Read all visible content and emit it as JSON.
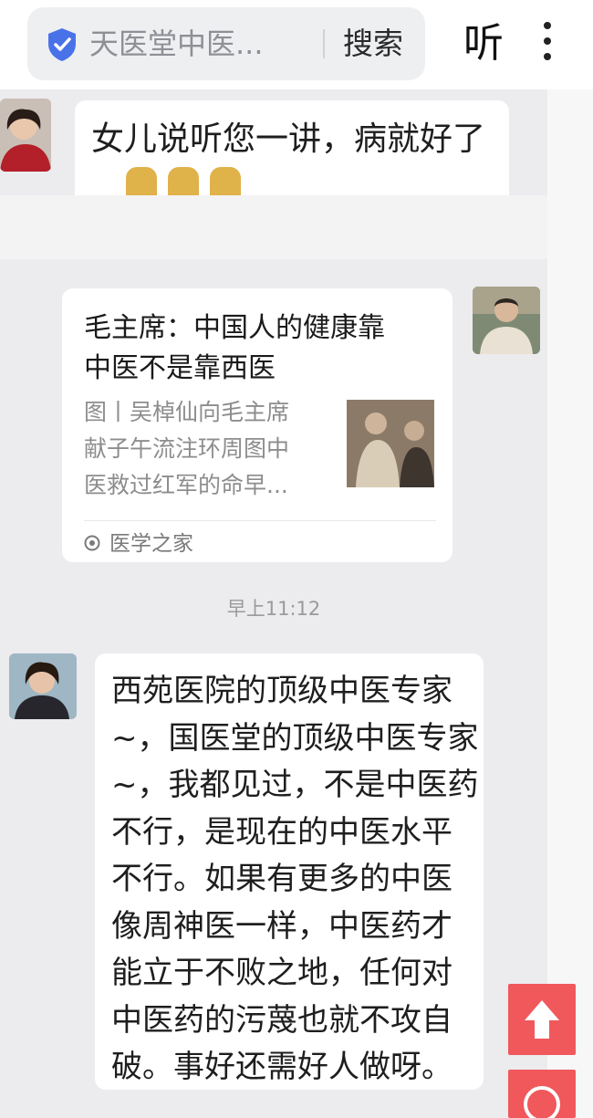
{
  "header": {
    "site_title": "天医堂中医...",
    "search_label": "搜索",
    "listen_label": "听",
    "icons": {
      "shield": "shield-check-icon",
      "more": "more-vertical-icon"
    }
  },
  "messages": [
    {
      "type": "text",
      "side": "left",
      "text": "女儿说听您一讲，病就好了",
      "trailing_icons": [
        "thumbs-up-icon",
        "thumbs-up-icon",
        "thumbs-up-icon"
      ]
    },
    {
      "type": "link_card",
      "side": "right",
      "title_lines": [
        "毛主席：中国人的健康靠",
        "中医不是靠西医"
      ],
      "desc_lines": [
        "图丨吴棹仙向毛主席",
        "献子午流注环周图中",
        "医救过红军的命早..."
      ],
      "source": "医学之家"
    },
    {
      "type": "timestamp",
      "text": "早上11:12"
    },
    {
      "type": "text",
      "side": "left",
      "lines": [
        "西苑医院的顶级中医专家",
        "~，国医堂的顶级中医专家",
        "~，我都见过，不是中医药",
        "不行，是现在的中医水平",
        "不行。如果有更多的中医",
        "像周神医一样，中医药才",
        "能立于不败之地，任何对",
        "中医药的污蔑也就不攻自",
        "破。事好还需好人做呀。"
      ]
    }
  ],
  "float_buttons": {
    "up_icon": "arrow-up-icon",
    "down_icon": "scroll-down-icon"
  },
  "colors": {
    "chat_bg": "#ecebee",
    "bubble": "#ffffff",
    "float_button": "#f0585b",
    "shield": "#4a72e8"
  }
}
